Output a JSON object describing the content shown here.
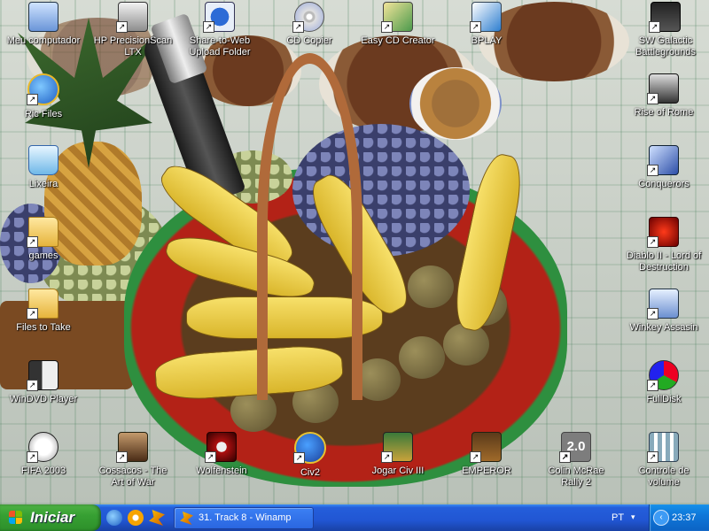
{
  "desktop": {
    "icons": [
      {
        "label": "Meu computador",
        "icon": "my-computer-icon",
        "shortcut": false
      },
      {
        "label": "HP PrecisionScan LTX",
        "icon": "scanner-icon",
        "shortcut": true
      },
      {
        "label": "Share-to-Web Upload Folder",
        "icon": "hp-upload-icon",
        "shortcut": true
      },
      {
        "label": "CD Copier",
        "icon": "cd-copier-icon",
        "shortcut": true
      },
      {
        "label": "Easy CD Creator",
        "icon": "easy-cd-creator-icon",
        "shortcut": true
      },
      {
        "label": "BPLAY",
        "icon": "bplay-icon",
        "shortcut": true
      },
      {
        "label": "SW Galactic Battlegrounds",
        "icon": "star-wars-icon",
        "shortcut": true
      },
      {
        "label": "Ric Files",
        "icon": "internet-explorer-icon",
        "shortcut": true
      },
      {
        "label": "Rise of Rome",
        "icon": "rise-of-rome-icon",
        "shortcut": true
      },
      {
        "label": "Lixeira",
        "icon": "recycle-bin-icon",
        "shortcut": false
      },
      {
        "label": "Conquerors",
        "icon": "conquerors-icon",
        "shortcut": true
      },
      {
        "label": "games",
        "icon": "folder-icon",
        "shortcut": true
      },
      {
        "label": "Diablo II - Lord of Destruction",
        "icon": "diablo-icon",
        "shortcut": true
      },
      {
        "label": "Files to Take",
        "icon": "folder-icon",
        "shortcut": true
      },
      {
        "label": "Winkey Assasin",
        "icon": "keyboard-icon",
        "shortcut": true
      },
      {
        "label": "WinDVD Player",
        "icon": "windvd-icon",
        "shortcut": true
      },
      {
        "label": "FullDisk",
        "icon": "fulldisk-icon",
        "shortcut": true
      },
      {
        "label": "FIFA 2003",
        "icon": "soccer-ball-icon",
        "shortcut": true
      },
      {
        "label": "Cossacos - The Art of War",
        "icon": "cossacks-icon",
        "shortcut": true
      },
      {
        "label": "Wolfenstein",
        "icon": "wolfenstein-icon",
        "shortcut": true
      },
      {
        "label": "Civ2",
        "icon": "civ2-icon",
        "shortcut": true
      },
      {
        "label": "Jogar Civ III",
        "icon": "civ3-icon",
        "shortcut": true
      },
      {
        "label": "EMPEROR",
        "icon": "emperor-icon",
        "shortcut": true
      },
      {
        "label": "Colin McRae Rally 2",
        "icon": "colin-mcrae-icon",
        "shortcut": true
      },
      {
        "label": "Controle de volume",
        "icon": "volume-control-icon",
        "shortcut": true
      }
    ],
    "rally_badge": "2.0"
  },
  "taskbar": {
    "start_label": "Iniciar",
    "quick_launch": [
      "internet-explorer-icon",
      "media-player-icon",
      "winamp-icon"
    ],
    "tasks": [
      {
        "label": "31. Track 8 - Winamp",
        "icon": "winamp-icon"
      }
    ],
    "language": "PT",
    "clock": "23:37"
  },
  "colors": {
    "taskbar": "#245edb",
    "start_button": "#37a033",
    "tray": "#0f77d9"
  }
}
